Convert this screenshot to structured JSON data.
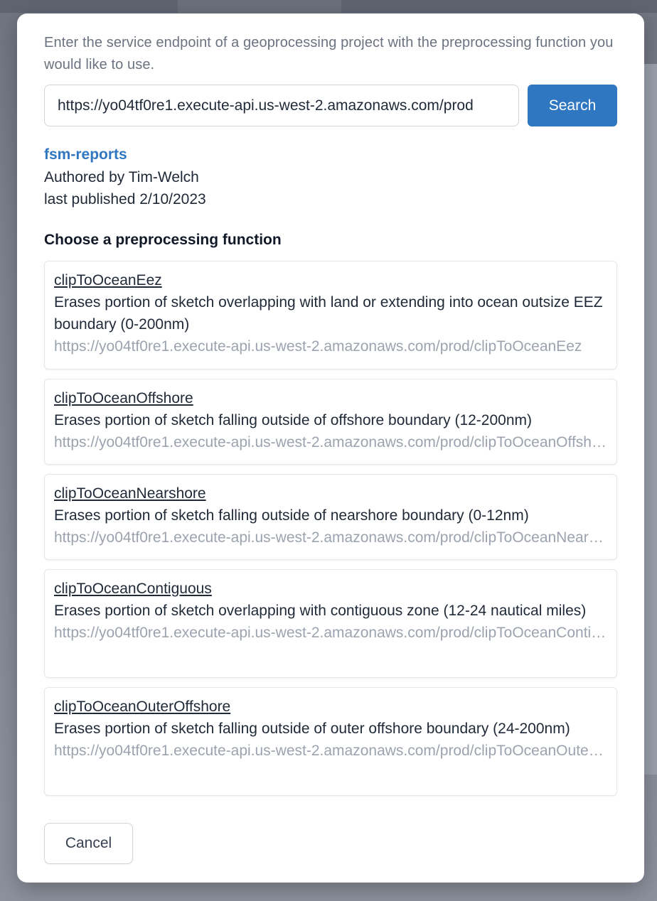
{
  "dialog": {
    "intro_text": "Enter the service endpoint of a geoprocessing project with the preprocessing function you would like to use.",
    "endpoint_value": "https://yo04tf0re1.execute-api.us-west-2.amazonaws.com/prod",
    "search_label": "Search",
    "cancel_label": "Cancel"
  },
  "project": {
    "name": "fsm-reports",
    "authored_by": "Authored by Tim-Welch",
    "last_published": "last published 2/10/2023"
  },
  "functions_heading": "Choose a preprocessing function",
  "functions": [
    {
      "name": "clipToOceanEez",
      "description": "Erases portion of sketch overlapping with land or extending into ocean outsize EEZ boundary (0-200nm)",
      "url": "https://yo04tf0re1.execute-api.us-west-2.amazonaws.com/prod/clipToOceanEez"
    },
    {
      "name": "clipToOceanOffshore",
      "description": "Erases portion of sketch falling outside of offshore boundary (12-200nm)",
      "url": "https://yo04tf0re1.execute-api.us-west-2.amazonaws.com/prod/clipToOceanOffshore"
    },
    {
      "name": "clipToOceanNearshore",
      "description": "Erases portion of sketch falling outside of nearshore boundary (0-12nm)",
      "url": "https://yo04tf0re1.execute-api.us-west-2.amazonaws.com/prod/clipToOceanNearshore"
    },
    {
      "name": "clipToOceanContiguous",
      "description": "Erases portion of sketch overlapping with contiguous zone (12-24 nautical miles)",
      "url": "https://yo04tf0re1.execute-api.us-west-2.amazonaws.com/prod/clipToOceanContiguous"
    },
    {
      "name": "clipToOceanOuterOffshore",
      "description": "Erases portion of sketch falling outside of outer offshore boundary (24-200nm)",
      "url": "https://yo04tf0re1.execute-api.us-west-2.amazonaws.com/prod/clipToOceanOuterOffshore"
    }
  ]
}
